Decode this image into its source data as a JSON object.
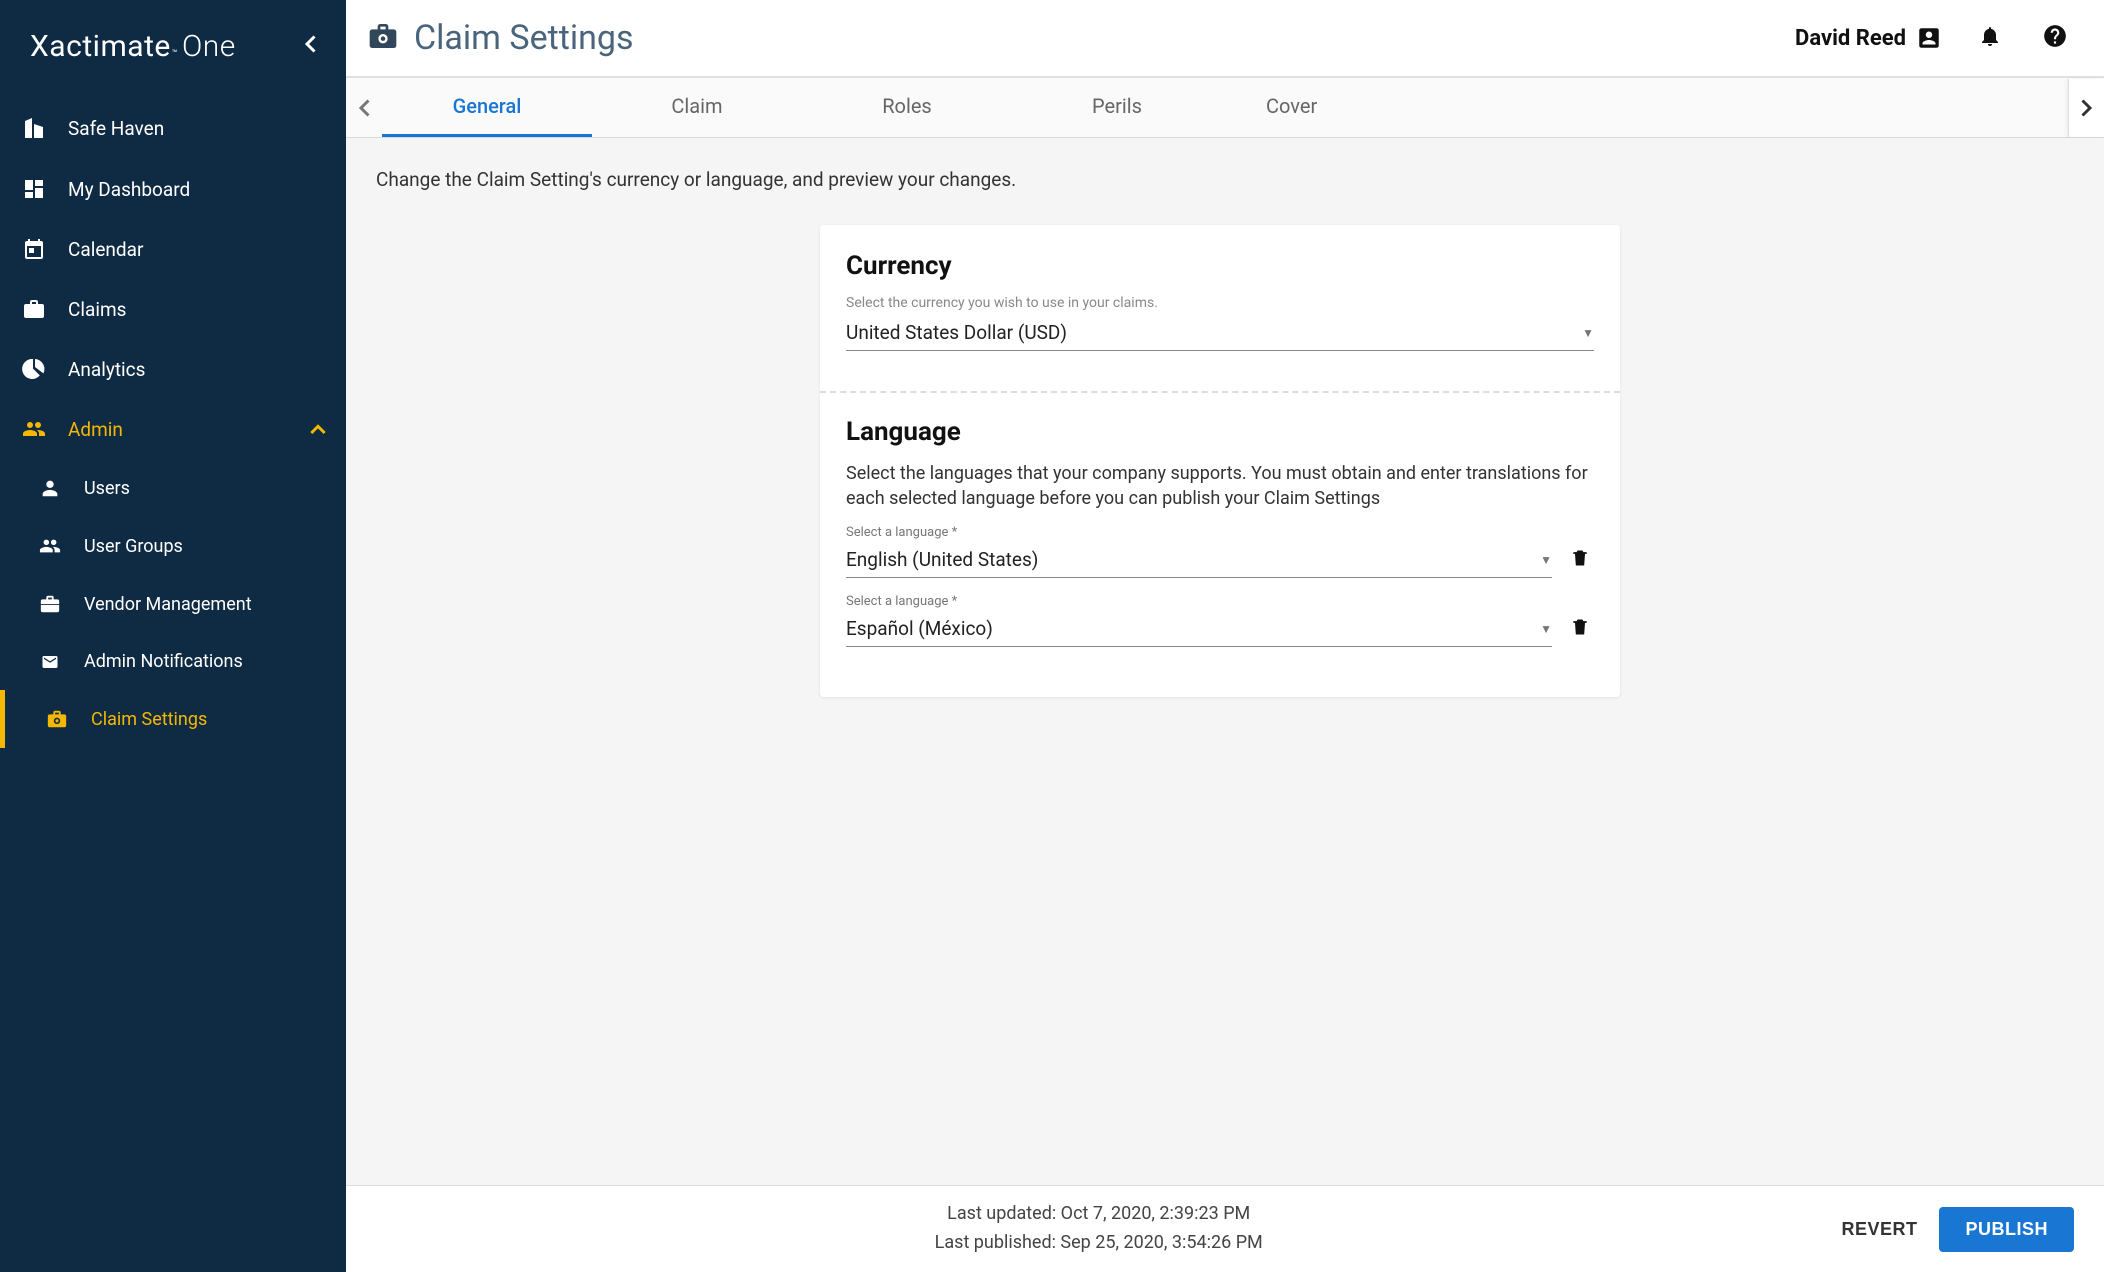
{
  "brand": {
    "name1": "Xactimate",
    "tm": "™",
    "name2": "One"
  },
  "sidebar": {
    "items": [
      {
        "label": "Safe Haven"
      },
      {
        "label": "My Dashboard"
      },
      {
        "label": "Calendar"
      },
      {
        "label": "Claims"
      },
      {
        "label": "Analytics"
      },
      {
        "label": "Admin"
      }
    ],
    "admin_sub": [
      {
        "label": "Users"
      },
      {
        "label": "User Groups"
      },
      {
        "label": "Vendor Management"
      },
      {
        "label": "Admin Notifications"
      },
      {
        "label": "Claim Settings"
      }
    ]
  },
  "header": {
    "page_title": "Claim Settings",
    "user_name": "David Reed"
  },
  "tabs": [
    {
      "label": "General",
      "active": true
    },
    {
      "label": "Claim"
    },
    {
      "label": "Roles"
    },
    {
      "label": "Perils"
    },
    {
      "label": "Cover"
    }
  ],
  "content": {
    "intro": "Change the Claim Setting's currency or language, and preview your changes.",
    "currency": {
      "title": "Currency",
      "hint": "Select the currency you wish to use in your claims.",
      "value": "United States Dollar (USD)"
    },
    "language": {
      "title": "Language",
      "desc": "Select the languages that your company supports. You must obtain and enter translations for each selected language before you can publish your Claim Settings",
      "field_label": "Select a language *",
      "rows": [
        {
          "value": "English (United States)"
        },
        {
          "value": "Español (México)"
        }
      ]
    }
  },
  "footer": {
    "last_updated": "Last updated: Oct 7, 2020, 2:39:23 PM",
    "last_published": "Last published: Sep 25, 2020, 3:54:26 PM",
    "revert_label": "REVERT",
    "publish_label": "PUBLISH"
  }
}
